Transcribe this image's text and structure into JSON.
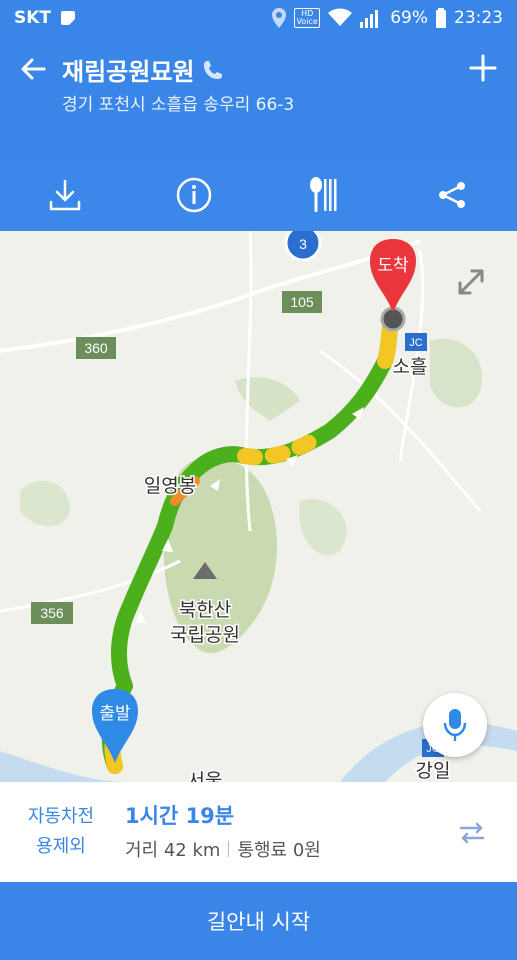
{
  "status": {
    "carrier": "SKT",
    "battery": "69%",
    "time": "23:23",
    "hd_voice": "HD Voice"
  },
  "header": {
    "title": "재림공원묘원",
    "address": "경기 포천시 소흘읍 송우리 66-3"
  },
  "toolbar": {
    "items": [
      "download-icon",
      "info-icon",
      "restaurant-icon",
      "share-icon"
    ]
  },
  "map": {
    "route_label_badge_3": "3",
    "road_105": "105",
    "road_360": "360",
    "road_356": "356",
    "place_ilyeongbong": "일영봉",
    "place_bukhansan_1": "북한산",
    "place_bukhansan_2": "국립공원",
    "place_soheul": "소흘",
    "place_gangil": "강일",
    "place_seoul": "서울",
    "jc": "JC",
    "start_label": "출발",
    "end_label": "도착"
  },
  "summary": {
    "mode_line1": "자동차전",
    "mode_line2": "용제외",
    "time": "1시간 19분",
    "distance": "거리 42 km",
    "toll": "통행료 0원"
  },
  "start_button": "길안내 시작",
  "colors": {
    "primary": "#3a86e8",
    "route_green": "#4caf1c",
    "route_yellow": "#f3c623",
    "route_orange": "#f08c2a",
    "marker_red": "#e8363c",
    "marker_blue": "#2f8ae6"
  }
}
